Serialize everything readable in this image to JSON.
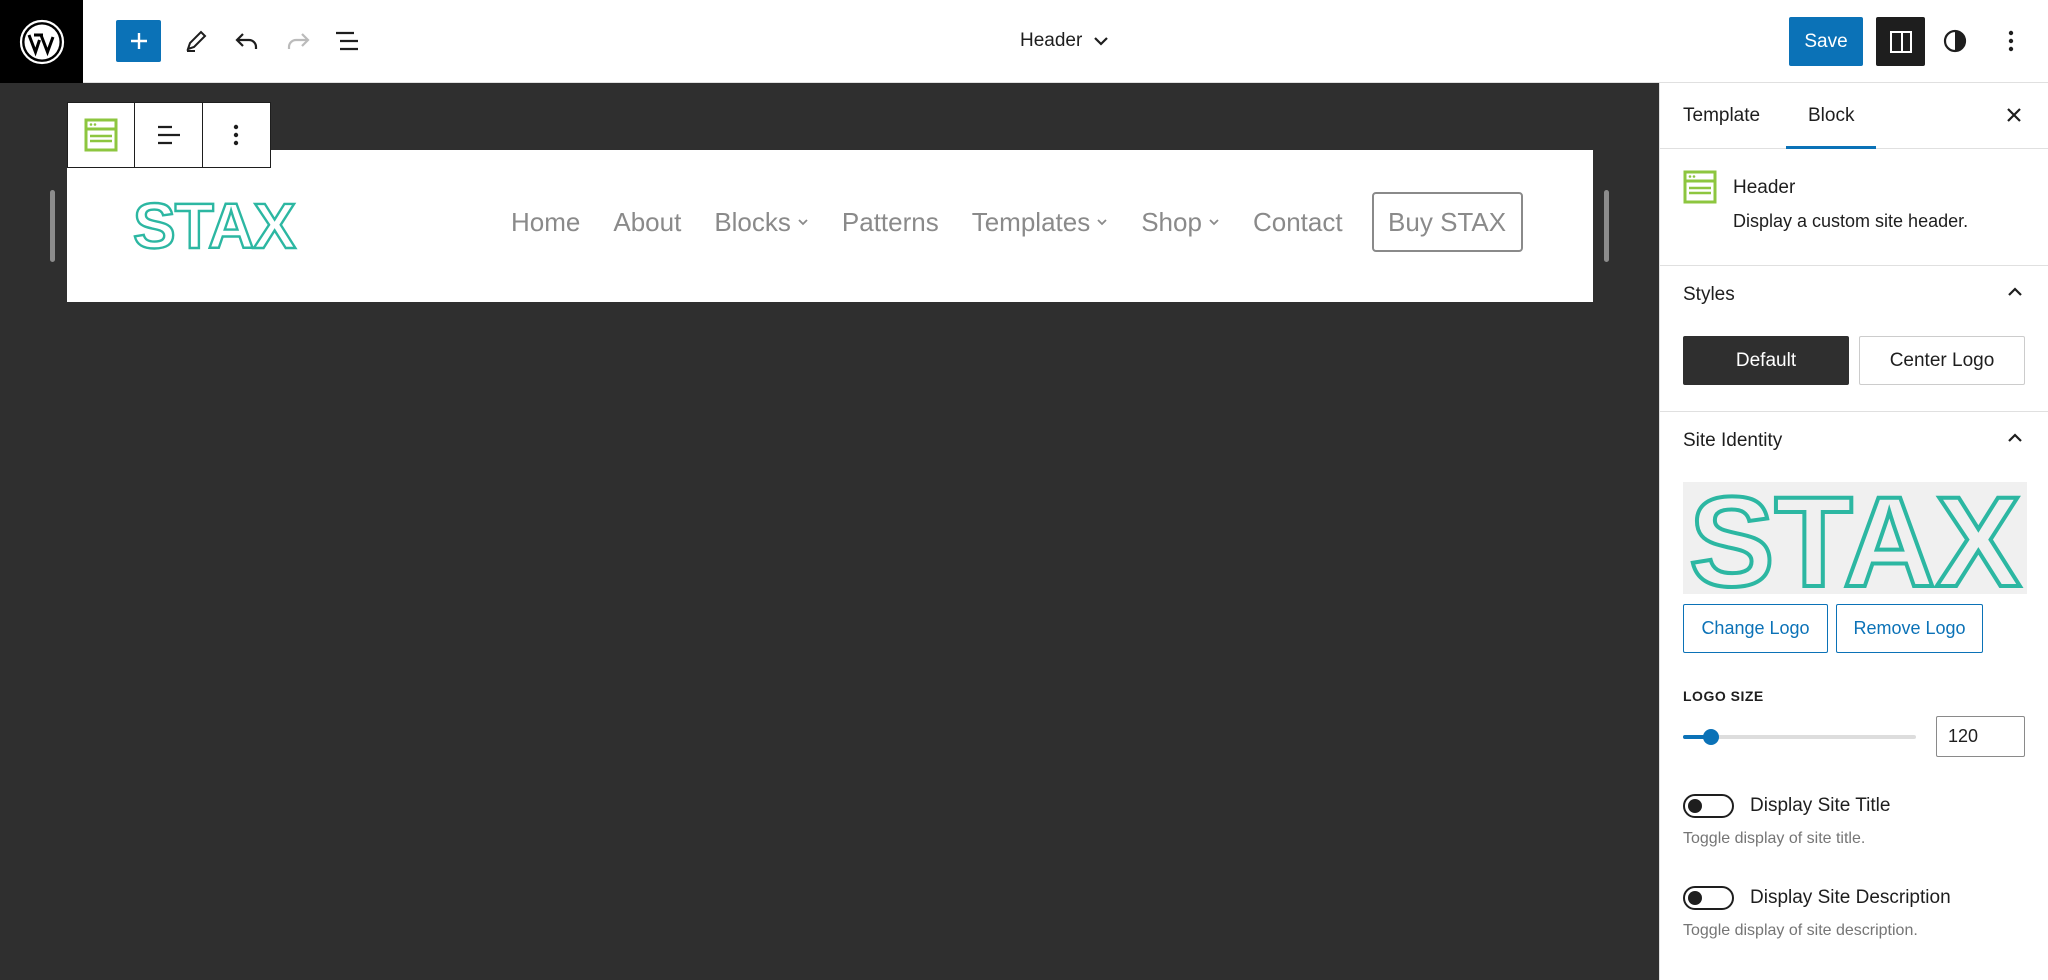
{
  "topbar": {
    "wp_logo_icon": "wordpress-icon",
    "add_icon": "plus-icon",
    "tools_icon": "pencil-icon",
    "undo_icon": "undo-icon",
    "redo_icon": "redo-icon",
    "list_view_icon": "list-view-icon",
    "document_title": "Header",
    "save_label": "Save",
    "settings_icon": "sidebar-icon",
    "styles_icon": "half-circle-icon",
    "more_icon": "more-vertical-icon"
  },
  "canvas": {
    "block_toolbar": {
      "block_icon": "header-block-icon",
      "align_icon": "align-left-icon",
      "options_icon": "more-vertical-icon"
    },
    "site_logo": "STAX",
    "nav": [
      {
        "label": "Home",
        "has_submenu": false
      },
      {
        "label": "About",
        "has_submenu": false
      },
      {
        "label": "Blocks",
        "has_submenu": true
      },
      {
        "label": "Patterns",
        "has_submenu": false
      },
      {
        "label": "Templates",
        "has_submenu": true
      },
      {
        "label": "Shop",
        "has_submenu": true
      },
      {
        "label": "Contact",
        "has_submenu": false
      }
    ],
    "buy_button": "Buy STAX"
  },
  "sidebar": {
    "tabs": [
      "Template",
      "Block"
    ],
    "active_tab": "Block",
    "block": {
      "title": "Header",
      "description": "Display a custom site header."
    },
    "styles": {
      "heading": "Styles",
      "options": [
        "Default",
        "Center Logo"
      ],
      "selected": "Default"
    },
    "site_identity": {
      "heading": "Site Identity",
      "logo_text": "STAX",
      "change_logo": "Change Logo",
      "remove_logo": "Remove Logo",
      "logo_size_label": "LOGO SIZE",
      "logo_size_value": "120",
      "logo_size_fraction": 0.12,
      "toggles": [
        {
          "label": "Display Site Title",
          "help": "Toggle display of site title.",
          "on": false
        },
        {
          "label": "Display Site Description",
          "help": "Toggle display of site description.",
          "on": false
        }
      ]
    }
  },
  "colors": {
    "accent": "#0b72b7",
    "logo_teal": "#2cb7a2",
    "block_icon_green": "#8dc63f",
    "canvas_bg": "#2f2f2f"
  }
}
